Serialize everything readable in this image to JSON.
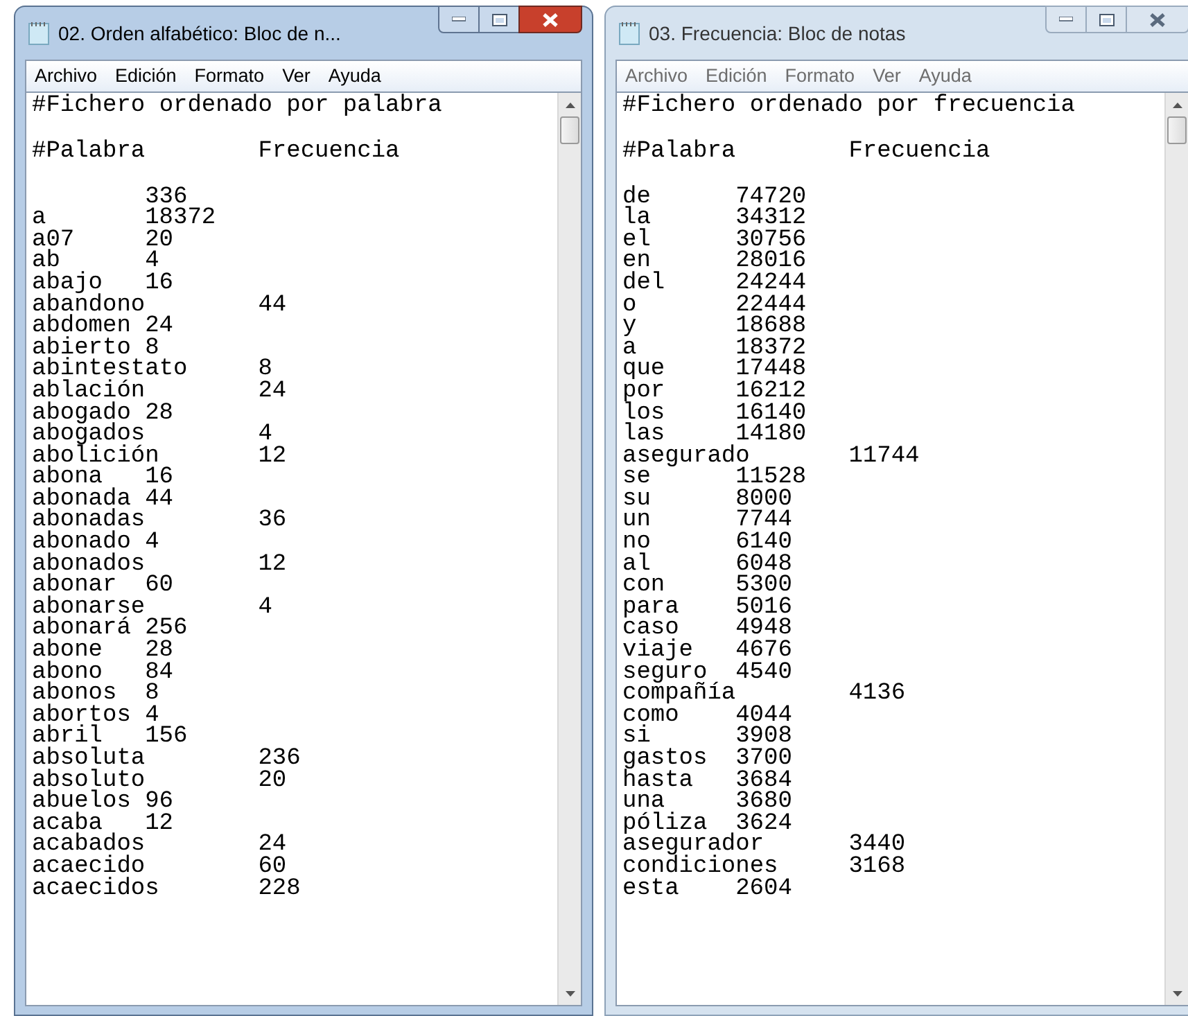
{
  "windows": [
    {
      "title": "02. Orden alfabético: Bloc de n...",
      "active": true,
      "menu": [
        "Archivo",
        "Edición",
        "Formato",
        "Ver",
        "Ayuda"
      ],
      "heading": "#Fichero ordenado por palabra",
      "columns": [
        "#Palabra",
        "Frecuencia"
      ],
      "rows": [
        {
          "count": "336"
        },
        {
          "word": "a",
          "count": "18372"
        },
        {
          "word": "a07",
          "count": "20"
        },
        {
          "word": "ab",
          "count": "4"
        },
        {
          "word": "abajo",
          "count": "16"
        },
        {
          "word": "abandono",
          "count": "44"
        },
        {
          "word": "abdomen",
          "count": "24"
        },
        {
          "word": "abierto",
          "count": "8"
        },
        {
          "word": "abintestato",
          "count": "8"
        },
        {
          "word": "ablación",
          "count": "24"
        },
        {
          "word": "abogado",
          "count": "28"
        },
        {
          "word": "abogados",
          "count": "4"
        },
        {
          "word": "abolición",
          "count": "12"
        },
        {
          "word": "abona",
          "count": "16"
        },
        {
          "word": "abonada",
          "count": "44"
        },
        {
          "word": "abonadas",
          "count": "36"
        },
        {
          "word": "abonado",
          "count": "4"
        },
        {
          "word": "abonados",
          "count": "12"
        },
        {
          "word": "abonar",
          "count": "60"
        },
        {
          "word": "abonarse",
          "count": "4"
        },
        {
          "word": "abonará",
          "count": "256"
        },
        {
          "word": "abone",
          "count": "28"
        },
        {
          "word": "abono",
          "count": "84"
        },
        {
          "word": "abonos",
          "count": "8"
        },
        {
          "word": "abortos",
          "count": "4"
        },
        {
          "word": "abril",
          "count": "156"
        },
        {
          "word": "absoluta",
          "count": "236"
        },
        {
          "word": "absoluto",
          "count": "20"
        },
        {
          "word": "abuelos",
          "count": "96"
        },
        {
          "word": "acaba",
          "count": "12"
        },
        {
          "word": "acabados",
          "count": "24"
        },
        {
          "word": "acaecido",
          "count": "60"
        },
        {
          "word": "acaecidos",
          "count": "228"
        }
      ]
    },
    {
      "title": "03. Frecuencia: Bloc de notas",
      "active": false,
      "menu": [
        "Archivo",
        "Edición",
        "Formato",
        "Ver",
        "Ayuda"
      ],
      "heading": "#Fichero ordenado por frecuencia",
      "columns": [
        "#Palabra",
        "Frecuencia"
      ],
      "rows": [
        {
          "word": "de",
          "count": "74720"
        },
        {
          "word": "la",
          "count": "34312"
        },
        {
          "word": "el",
          "count": "30756"
        },
        {
          "word": "en",
          "count": "28016"
        },
        {
          "word": "del",
          "count": "24244"
        },
        {
          "word": "o",
          "count": "22444"
        },
        {
          "word": "y",
          "count": "18688"
        },
        {
          "word": "a",
          "count": "18372"
        },
        {
          "word": "que",
          "count": "17448"
        },
        {
          "word": "por",
          "count": "16212"
        },
        {
          "word": "los",
          "count": "16140"
        },
        {
          "word": "las",
          "count": "14180"
        },
        {
          "word": "asegurado",
          "count": "11744"
        },
        {
          "word": "se",
          "count": "11528"
        },
        {
          "word": "su",
          "count": "8000"
        },
        {
          "word": "un",
          "count": "7744"
        },
        {
          "word": "no",
          "count": "6140"
        },
        {
          "word": "al",
          "count": "6048"
        },
        {
          "word": "con",
          "count": "5300"
        },
        {
          "word": "para",
          "count": "5016"
        },
        {
          "word": "caso",
          "count": "4948"
        },
        {
          "word": "viaje",
          "count": "4676"
        },
        {
          "word": "seguro",
          "count": "4540"
        },
        {
          "word": "compañía",
          "count": "4136"
        },
        {
          "word": "como",
          "count": "4044"
        },
        {
          "word": "si",
          "count": "3908"
        },
        {
          "word": "gastos",
          "count": "3700"
        },
        {
          "word": "hasta",
          "count": "3684"
        },
        {
          "word": "una",
          "count": "3680"
        },
        {
          "word": "póliza",
          "count": "3624"
        },
        {
          "word": "asegurador",
          "count": "3440"
        },
        {
          "word": "condiciones",
          "count": "3168"
        },
        {
          "word": "esta",
          "count": "2604"
        }
      ]
    }
  ]
}
